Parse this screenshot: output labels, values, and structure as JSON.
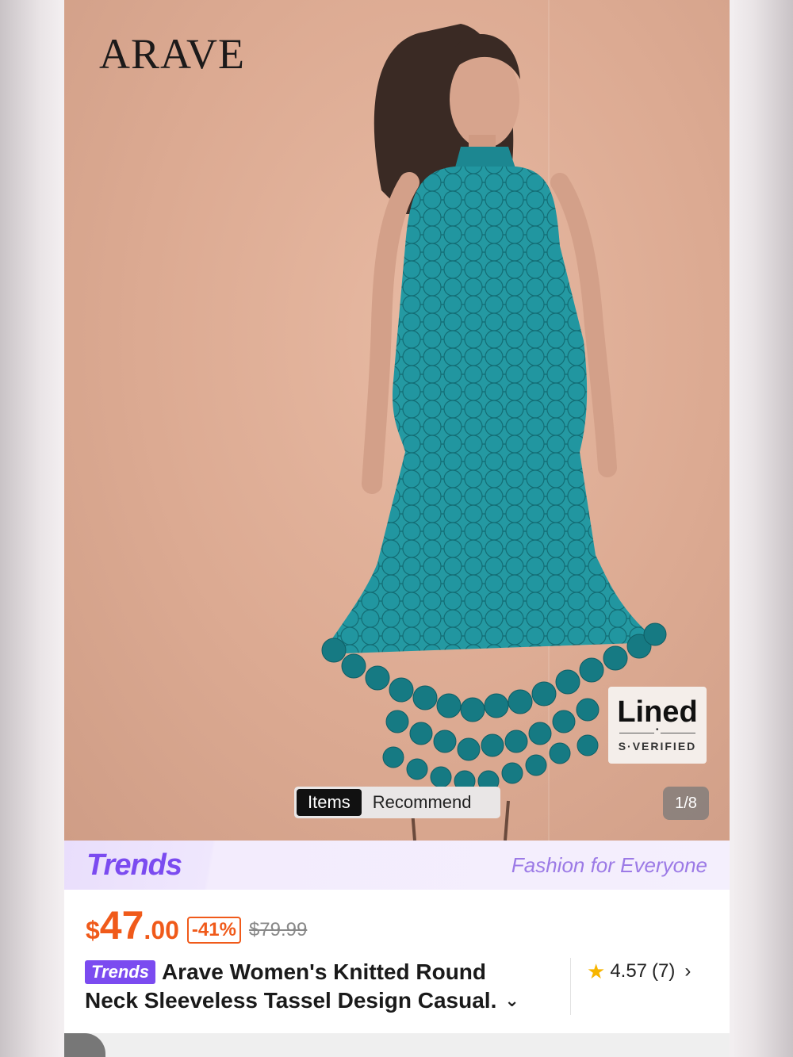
{
  "product_image": {
    "brand_logo": "ARAVE",
    "badge": {
      "title": "Lined",
      "subtitle": "S·VERIFIED"
    },
    "toggle": {
      "items_label": "Items",
      "recommend_label": "Recommend"
    },
    "counter": "1/8"
  },
  "trends_banner": {
    "logo": "Trends",
    "tagline": "Fashion for Everyone"
  },
  "price": {
    "currency": "$",
    "integer": "47",
    "decimal": ".00",
    "discount": "-41%",
    "original": "$79.99"
  },
  "product": {
    "chip": "Trends",
    "title_line1": "Arave Women's Knitted Round",
    "title_line2": "Neck Sleeveless Tassel Design Casual",
    "ellipsis": "."
  },
  "rating": {
    "value": "4.57",
    "count": "(7)"
  },
  "colors": {
    "price": "#f05a1a",
    "trends": "#7b4bf0",
    "dress": "#1e8e96",
    "star": "#f7b500"
  }
}
